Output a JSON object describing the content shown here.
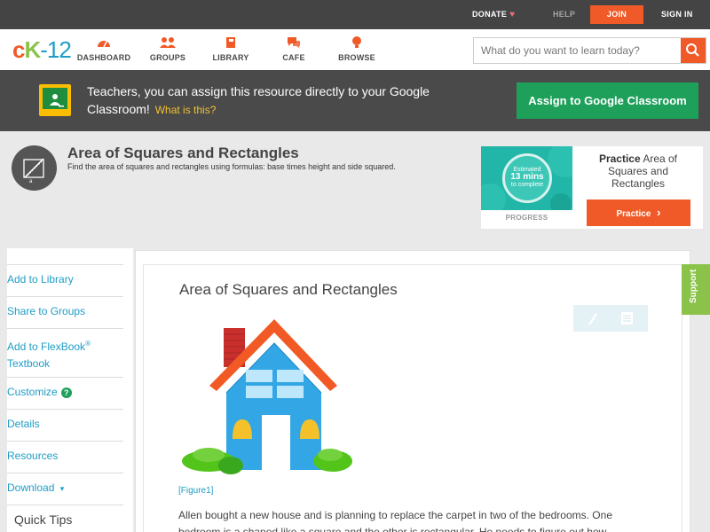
{
  "topbar": {
    "donate": "DONATE",
    "help": "HELP",
    "join": "JOIN",
    "signin": "SIGN IN"
  },
  "nav": {
    "logo": {
      "c": "c",
      "k": "K",
      "dash": "-",
      "n": "12"
    },
    "items": [
      {
        "label": "DASHBOARD",
        "icon": "dashboard-icon"
      },
      {
        "label": "GROUPS",
        "icon": "groups-icon"
      },
      {
        "label": "LIBRARY",
        "icon": "library-icon"
      },
      {
        "label": "CAFE",
        "icon": "cafe-icon"
      },
      {
        "label": "BROWSE",
        "icon": "browse-icon"
      }
    ],
    "search_placeholder": "What do you want to learn today?"
  },
  "banner": {
    "text": "Teachers, you can assign this resource directly to your Google Classroom!",
    "what": "What is this?",
    "assign_button": "Assign to Google Classroom"
  },
  "concept": {
    "title": "Area of Squares and Rectangles",
    "description": "Find the area of squares and rectangles using formulas: base times height and side squared."
  },
  "practice": {
    "estimated": "Estimated",
    "mins": "13 mins",
    "complete": "to complete",
    "progress": "PROGRESS",
    "title_bold": "Practice",
    "title_rest": "Area of Squares and Rectangles",
    "button": "Practice"
  },
  "sidebar": {
    "add_library": "Add to Library",
    "share_groups": "Share to Groups",
    "add_flexbook": "Add to FlexBook",
    "reg": "®",
    "textbook": "Textbook",
    "customize": "Customize",
    "help_mark": "?",
    "details": "Details",
    "resources": "Resources",
    "download": "Download",
    "download_caret": "▾",
    "quick_tips": "Quick Tips"
  },
  "content": {
    "title": "Area of Squares and Rectangles",
    "figure_label": "[Figure1]",
    "paragraph": "Allen bought a new house and is planning to replace the carpet in two of the bedrooms. One bedroom is a shaped like a square and the other is rectangular. He needs to figure out how"
  },
  "support": "Support",
  "colors": {
    "accent_orange": "#f05a28",
    "link_blue": "#1e9dc5",
    "green": "#1ea05b",
    "support_green": "#8bc34a"
  }
}
